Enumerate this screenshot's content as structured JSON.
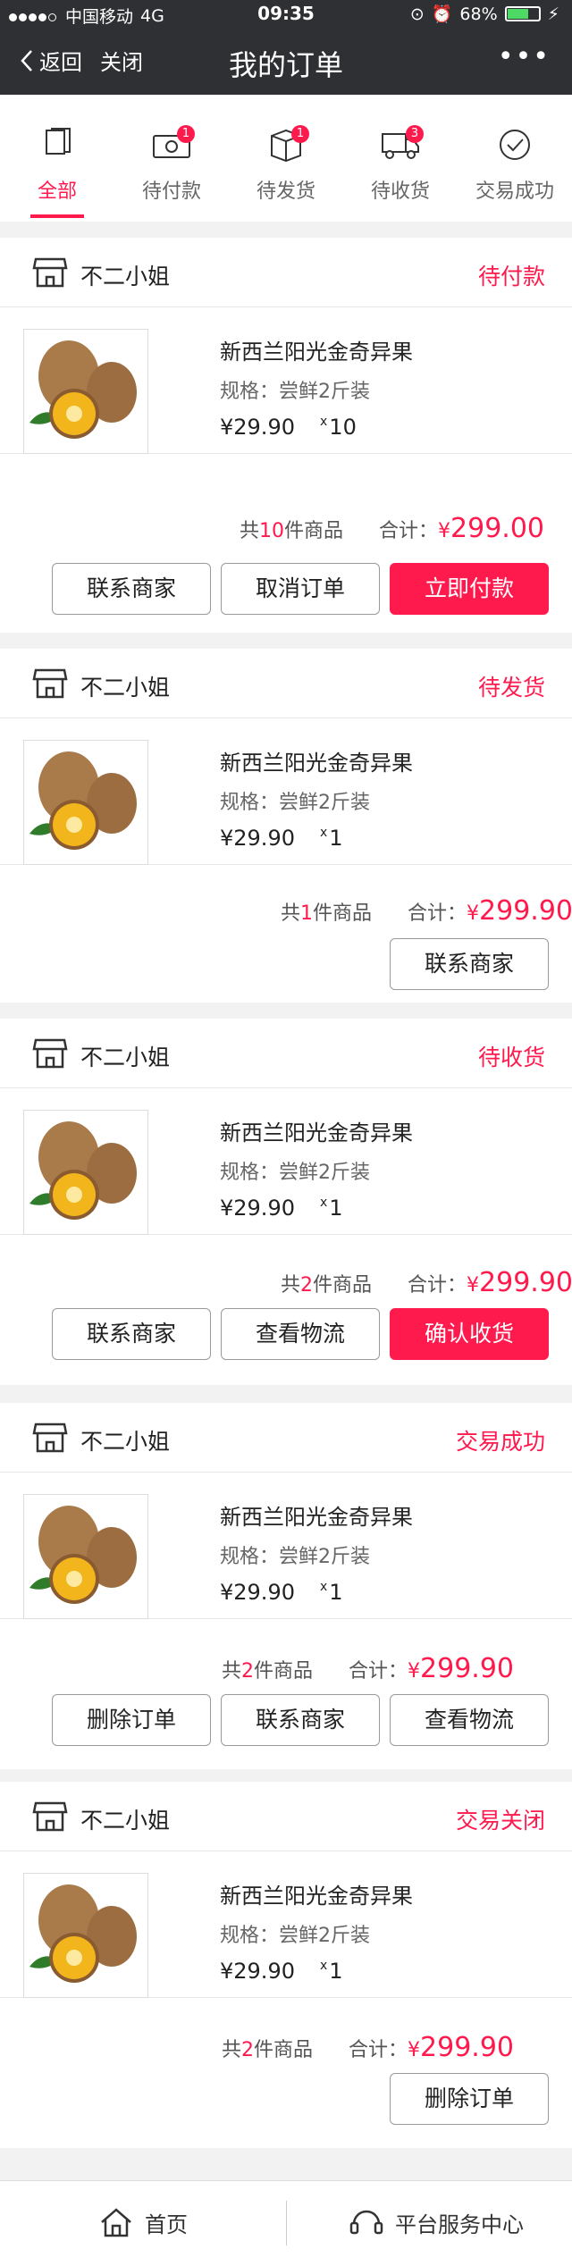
{
  "status_bar": {
    "carrier": "中国移动",
    "network": "4G",
    "time": "09:35",
    "battery": "68%"
  },
  "nav": {
    "back_label": "返回",
    "close_label": "关闭",
    "title": "我的订单",
    "more_label": "•••"
  },
  "tabs": [
    {
      "label": "全部",
      "icon": "documents-icon",
      "badge": ""
    },
    {
      "label": "待付款",
      "icon": "wallet-icon",
      "badge": "1"
    },
    {
      "label": "待发货",
      "icon": "box-icon",
      "badge": "1"
    },
    {
      "label": "待收货",
      "icon": "truck-icon",
      "badge": "3"
    },
    {
      "label": "交易成功",
      "icon": "check-circle-icon",
      "badge": ""
    }
  ],
  "accent_color": "#ff1a4d",
  "orders": [
    {
      "store": "不二小姐",
      "status": "待付款",
      "product": {
        "name": "新西兰阳光金奇异果",
        "spec": "规格：尝鲜2斤装",
        "price": "¥29.90",
        "qty_x": "x",
        "qty": "10"
      },
      "summary": {
        "prefix": "共",
        "count": "10",
        "suffix": "件商品",
        "total_label": "合计：",
        "currency": "¥",
        "total": "299.00"
      },
      "buttons": [
        "联系商家",
        "取消订单",
        "立即付款"
      ]
    },
    {
      "store": "不二小姐",
      "status": "待发货",
      "product": {
        "name": "新西兰阳光金奇异果",
        "spec": "规格：尝鲜2斤装",
        "price": "¥29.90",
        "qty_x": "x",
        "qty": "1"
      },
      "summary": {
        "prefix": "共",
        "count": "1",
        "suffix": "件商品",
        "total_label": "合计：",
        "currency": "¥",
        "total": "299.90"
      },
      "buttons": [
        "联系商家"
      ]
    },
    {
      "store": "不二小姐",
      "status": "待收货",
      "product": {
        "name": "新西兰阳光金奇异果",
        "spec": "规格：尝鲜2斤装",
        "price": "¥29.90",
        "qty_x": "x",
        "qty": "1"
      },
      "summary": {
        "prefix": "共",
        "count": "2",
        "suffix": "件商品",
        "total_label": "合计：",
        "currency": "¥",
        "total": "299.90"
      },
      "buttons": [
        "联系商家",
        "查看物流",
        "确认收货"
      ]
    },
    {
      "store": "不二小姐",
      "status": "交易成功",
      "product": {
        "name": "新西兰阳光金奇异果",
        "spec": "规格：尝鲜2斤装",
        "price": "¥29.90",
        "qty_x": "x",
        "qty": "1"
      },
      "summary": {
        "prefix": "共",
        "count": "2",
        "suffix": "件商品",
        "total_label": "合计：",
        "currency": "¥",
        "total": "299.90"
      },
      "buttons": [
        "删除订单",
        "联系商家",
        "查看物流"
      ]
    },
    {
      "store": "不二小姐",
      "status": "交易关闭",
      "product": {
        "name": "新西兰阳光金奇异果",
        "spec": "规格：尝鲜2斤装",
        "price": "¥29.90",
        "qty_x": "x",
        "qty": "1"
      },
      "summary": {
        "prefix": "共",
        "count": "2",
        "suffix": "件商品",
        "total_label": "合计：",
        "currency": "¥",
        "total": "299.90"
      },
      "buttons": [
        "删除订单"
      ]
    }
  ],
  "bottom_bar": {
    "home_label": "首页",
    "service_label": "平台服务中心"
  }
}
